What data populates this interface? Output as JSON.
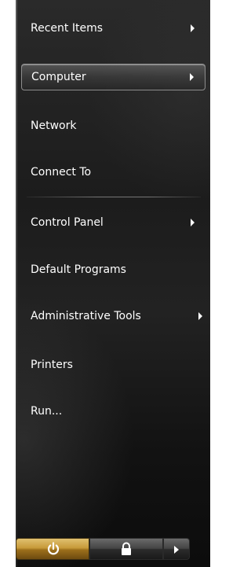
{
  "menu": {
    "items": [
      {
        "label": "Recent Items",
        "has_submenu": true,
        "selected": false
      },
      {
        "label": "Computer",
        "has_submenu": true,
        "selected": true
      },
      {
        "label": "Network",
        "has_submenu": false,
        "selected": false
      },
      {
        "label": "Connect To",
        "has_submenu": false,
        "selected": false
      },
      {
        "label": "Control Panel",
        "has_submenu": true,
        "selected": false
      },
      {
        "label": "Default Programs",
        "has_submenu": false,
        "selected": false
      },
      {
        "label": "Administrative Tools",
        "has_submenu": true,
        "selected": false
      },
      {
        "label": "Printers",
        "has_submenu": false,
        "selected": false
      },
      {
        "label": "Run...",
        "has_submenu": false,
        "selected": false
      }
    ]
  },
  "buttons": {
    "power": {
      "icon": "power-icon"
    },
    "lock": {
      "icon": "lock-icon"
    },
    "more": {
      "icon": "chevron-right-icon"
    }
  },
  "colors": {
    "text": "#ffffff",
    "power_button": "#c79a3a",
    "pane_background": "#1c1c1c"
  }
}
